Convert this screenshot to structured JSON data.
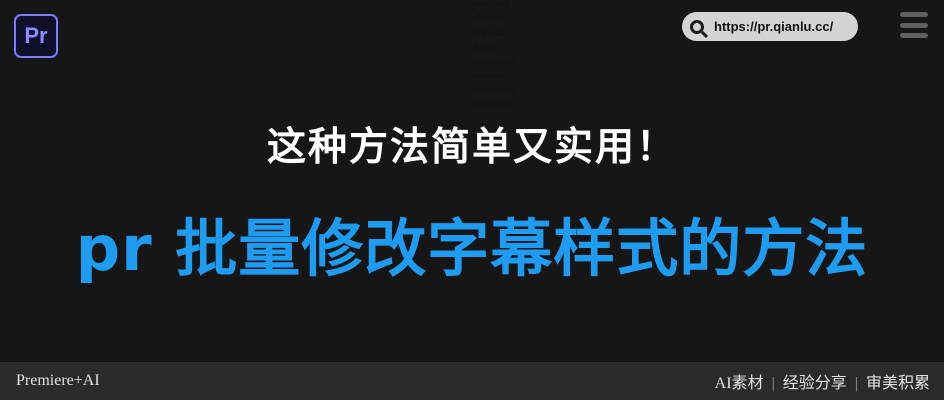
{
  "logo": {
    "text": "Pr"
  },
  "background_words": [
    "pendisse",
    "ultrices",
    "gravida.",
    "Risus",
    "commodo",
    "viverra",
    "maecenas",
    "accumsan"
  ],
  "header": {
    "url": "https://pr.qianlu.cc/"
  },
  "titles": {
    "subtitle": "这种方法简单又实用！",
    "main": "pr 批量修改字幕样式的方法"
  },
  "footer": {
    "left": "Premiere+AI",
    "right": [
      "AI素材",
      "经验分享",
      "审美积累"
    ],
    "separator": "|"
  },
  "colors": {
    "accent": "#1e9cf2",
    "logo_border": "#7b7cff",
    "background": "#161616",
    "footer_bg": "#2b2b2b"
  }
}
